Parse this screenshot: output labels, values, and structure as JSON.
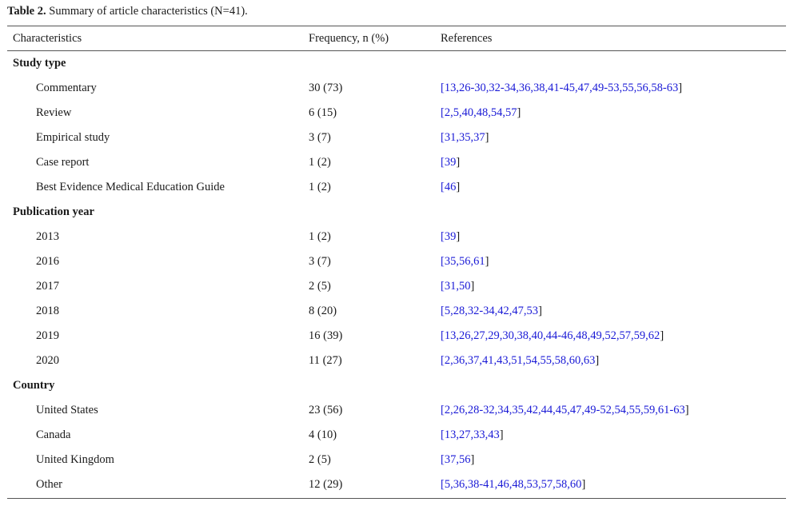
{
  "caption": {
    "label": "Table 2.",
    "title": "Summary of article characteristics (N=41)."
  },
  "headers": {
    "characteristics": "Characteristics",
    "frequency": "Frequency, n (%)",
    "references": "References"
  },
  "sections": [
    {
      "title": "Study type",
      "rows": [
        {
          "label": "Commentary",
          "freq": "30 (73)",
          "refs": "13,26-30,32-34,36,38,41-45,47,49-53,55,56,58-63"
        },
        {
          "label": "Review",
          "freq": "6 (15)",
          "refs": "2,5,40,48,54,57"
        },
        {
          "label": "Empirical study",
          "freq": "3 (7)",
          "refs": "31,35,37"
        },
        {
          "label": "Case report",
          "freq": "1 (2)",
          "refs": "39"
        },
        {
          "label": "Best Evidence Medical Education Guide",
          "freq": "1 (2)",
          "refs": "46"
        }
      ]
    },
    {
      "title": "Publication year",
      "rows": [
        {
          "label": "2013",
          "freq": "1 (2)",
          "refs": "39"
        },
        {
          "label": "2016",
          "freq": "3 (7)",
          "refs": "35,56,61"
        },
        {
          "label": "2017",
          "freq": "2 (5)",
          "refs": "31,50"
        },
        {
          "label": "2018",
          "freq": "8 (20)",
          "refs": "5,28,32-34,42,47,53"
        },
        {
          "label": "2019",
          "freq": "16 (39)",
          "refs": "13,26,27,29,30,38,40,44-46,48,49,52,57,59,62"
        },
        {
          "label": "2020",
          "freq": "11 (27)",
          "refs": "2,36,37,41,43,51,54,55,58,60,63"
        }
      ]
    },
    {
      "title": "Country",
      "rows": [
        {
          "label": "United States",
          "freq": "23 (56)",
          "refs": "2,26,28-32,34,35,42,44,45,47,49-52,54,55,59,61-63"
        },
        {
          "label": "Canada",
          "freq": "4 (10)",
          "refs": "13,27,33,43"
        },
        {
          "label": "United Kingdom",
          "freq": "2 (5)",
          "refs": "37,56"
        },
        {
          "label": "Other",
          "freq": "12 (29)",
          "refs": "5,36,38-41,46,48,53,57,58,60"
        }
      ]
    }
  ],
  "colors": {
    "text": "#1a1a1a",
    "link": "#1a1ad6",
    "rule": "#555555"
  }
}
